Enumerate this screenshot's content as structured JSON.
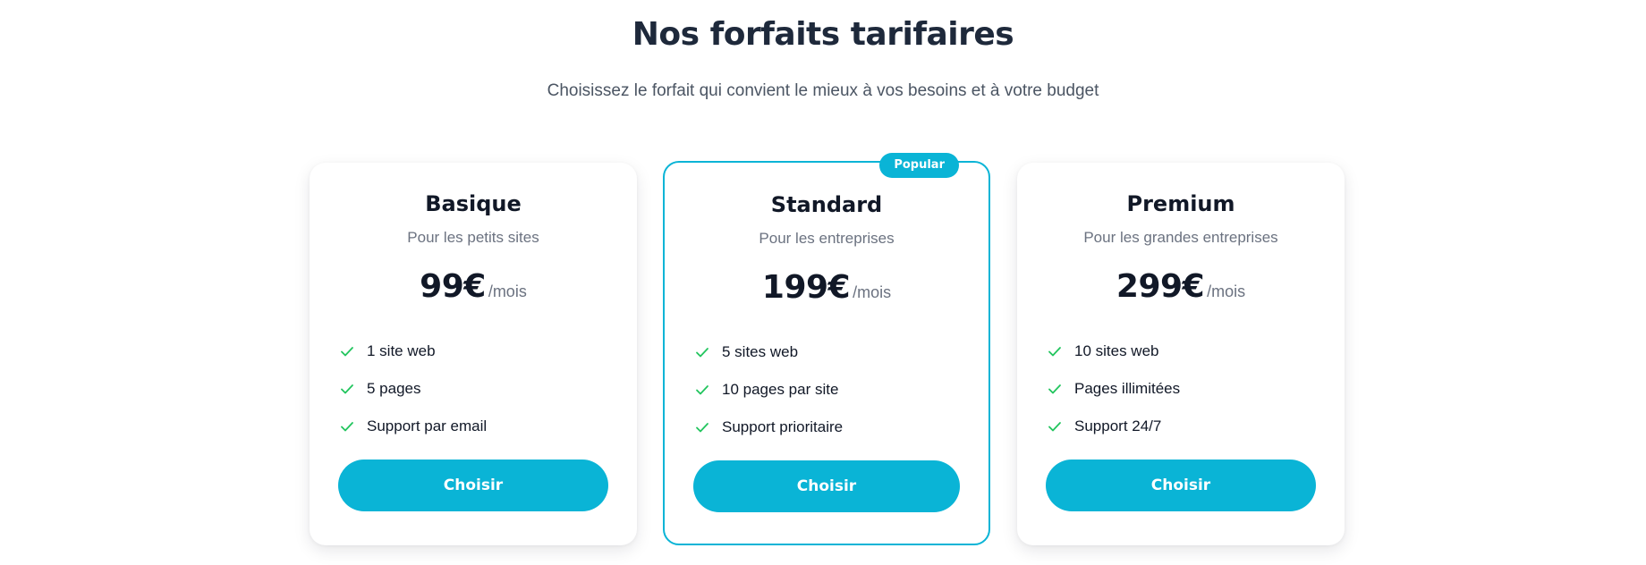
{
  "header": {
    "title": "Nos forfaits tarifaires",
    "subtitle": "Choisissez le forfait qui convient le mieux à vos besoins et à votre budget"
  },
  "colors": {
    "accent": "#0ab4d6",
    "check": "#22c55e",
    "heading": "#1e293b",
    "muted": "#6b7280"
  },
  "plans": [
    {
      "name": "Basique",
      "description": "Pour les petits sites",
      "price": "99€",
      "period": "/mois",
      "features": [
        "1 site web",
        "5 pages",
        "Support par email"
      ],
      "cta": "Choisir"
    },
    {
      "name": "Standard",
      "badge": "Popular",
      "description": "Pour les entreprises",
      "price": "199€",
      "period": "/mois",
      "features": [
        "5 sites web",
        "10 pages par site",
        "Support prioritaire"
      ],
      "cta": "Choisir"
    },
    {
      "name": "Premium",
      "description": "Pour les grandes entreprises",
      "price": "299€",
      "period": "/mois",
      "features": [
        "10 sites web",
        "Pages illimitées",
        "Support 24/7"
      ],
      "cta": "Choisir"
    }
  ],
  "icons": {
    "feature": "check-icon"
  }
}
